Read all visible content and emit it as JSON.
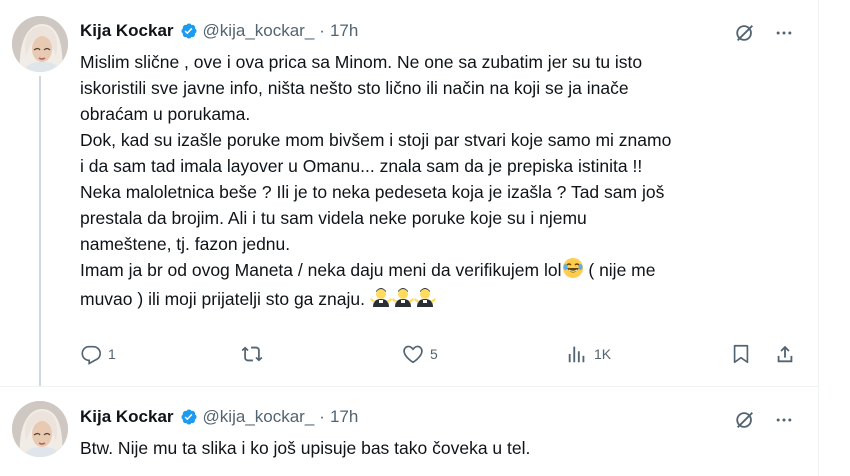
{
  "tweets": [
    {
      "author": {
        "name": "Kija Kockar",
        "handle": "@kija_kockar_",
        "time": "17h"
      },
      "text_lines": [
        "Mislim slične , ove i ova prica sa Minom. Ne one sa zubatim jer su tu isto",
        "iskoristili sve javne info, ništa nešto sto lično ili način na koji se ja inače",
        "obraćam u porukama.",
        "Dok, kad su izašle poruke mom bivšem i stoji par stvari koje samo mi znamo",
        "i da sam tad imala layover u Omanu... znala sam da je prepiska istinita !!",
        "Neka maloletnica beše ? Ili je to neka pedeseta koja je izašla ? Tad sam još",
        "prestala da brojim. Ali i tu sam videla neke poruke koje su i njemu",
        "nameštene, tj. fazon jednu.",
        "Imam ja br od ovog Maneta / neka daju meni da verifikujem lol",
        "( nije me",
        "muvao ) ili moji prijatelji sto ga znaju."
      ],
      "emoji": [
        "face-with-tears-of-joy",
        "person-shrugging",
        "person-shrugging",
        "person-shrugging"
      ],
      "stats": {
        "replies": "1",
        "likes": "5",
        "views": "1K"
      }
    },
    {
      "author": {
        "name": "Kija Kockar",
        "handle": "@kija_kockar_",
        "time": "17h"
      },
      "text": "Btw. Nije mu ta slika i ko još upisuje bas tako čoveka u tel."
    }
  ],
  "icons": {
    "verified": "verified-badge-icon",
    "grok": "grok-icon",
    "more": "more-icon",
    "reply": "reply-icon",
    "retweet": "retweet-icon",
    "like": "like-icon",
    "views": "views-icon",
    "bookmark": "bookmark-icon",
    "share": "share-icon"
  },
  "colors": {
    "text": "#0f1419",
    "secondary": "#536471",
    "verified": "#1d9bf0",
    "border": "#eff3f4"
  }
}
